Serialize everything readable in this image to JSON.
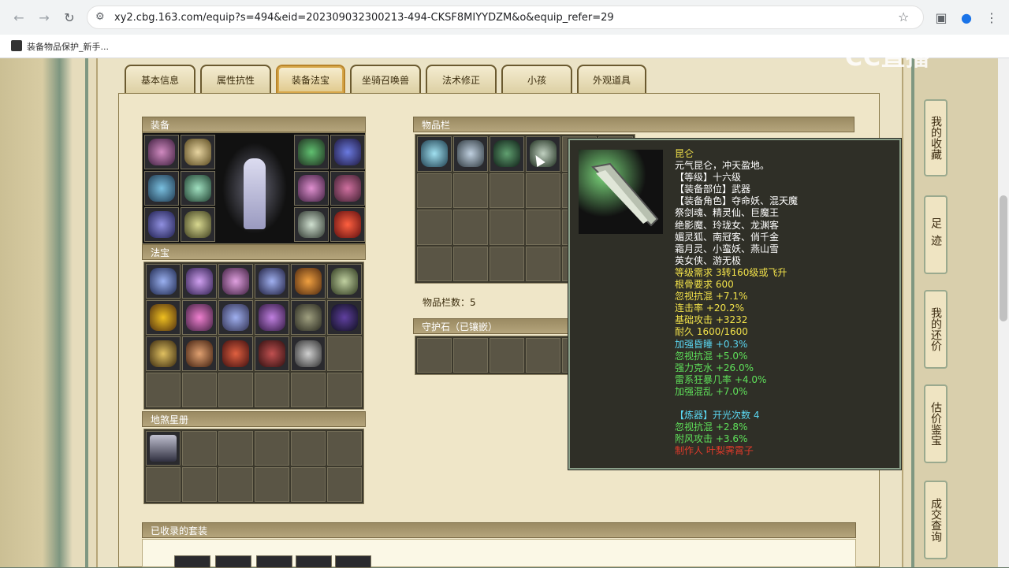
{
  "browser": {
    "url": "xy2.cbg.163.com/equip?s=494&eid=202309032300213-494-CKSF8MIYYDZM&o&equip_refer=29",
    "bookmark": "装备物品保护_新手..."
  },
  "tabs": [
    "基本信息",
    "属性抗性",
    "装备法宝",
    "坐骑召唤兽",
    "法术修正",
    "小孩",
    "外观道具"
  ],
  "panels": {
    "equip": "装备",
    "fabao": "法宝",
    "disha": "地煞星册",
    "inventory": "物品栏",
    "inventory_count": "物品栏数：5",
    "guardian": "守护石（已镶嵌）",
    "suits": "已收录的套装"
  },
  "tooltip": {
    "name": "昆仑",
    "lines": [
      {
        "text": "元气昆仑，冲天盈地。",
        "color": "#ffffff"
      },
      {
        "text": "【等级】十六级",
        "color": "#ffffff"
      },
      {
        "text": "【装备部位】武器",
        "color": "#ffffff"
      },
      {
        "text": "【装备角色】夺命妖、混天魔",
        "color": "#ffffff"
      },
      {
        "text": "祭剑魂、精灵仙、巨魔王",
        "color": "#ffffff"
      },
      {
        "text": "绝影魔、玲珑女、龙渊客",
        "color": "#ffffff"
      },
      {
        "text": "媚灵狐、南冠客、俏千金",
        "color": "#ffffff"
      },
      {
        "text": "霜月灵、小蛮妖、燕山雪",
        "color": "#ffffff"
      },
      {
        "text": "英女侠、游无极",
        "color": "#ffffff"
      },
      {
        "text": "等级需求 3转160级或飞升",
        "color": "#f2e24a"
      },
      {
        "text": "根骨要求 600",
        "color": "#f2e24a"
      },
      {
        "text": "忽视抗混 +7.1%",
        "color": "#f2e24a"
      },
      {
        "text": "连击率 +20.2%",
        "color": "#f2e24a"
      },
      {
        "text": "基础攻击 +3232",
        "color": "#f2e24a"
      },
      {
        "text": "耐久 1600/1600",
        "color": "#f2e24a"
      },
      {
        "text": "加强昏睡 +0.3%",
        "color": "#5ad6f0"
      },
      {
        "text": "忽视抗混 +5.0%",
        "color": "#5fe05a"
      },
      {
        "text": "强力克水 +26.0%",
        "color": "#5fe05a"
      },
      {
        "text": "雷系狂暴几率 +4.0%",
        "color": "#5fe05a"
      },
      {
        "text": "加强混乱 +7.0%",
        "color": "#5fe05a"
      },
      {
        "text": "",
        "color": "#ffffff"
      },
      {
        "text": "【炼器】开光次数 4",
        "color": "#5ad6f0"
      },
      {
        "text": "忽视抗混 +2.8%",
        "color": "#5fe05a"
      },
      {
        "text": "附风攻击 +3.6%",
        "color": "#5fe05a"
      },
      {
        "text": "制作人 叶梨霁霄子",
        "color": "#e03a2a"
      }
    ]
  },
  "side_buttons": [
    "我的收藏",
    "足迹",
    "我的还价",
    "估价鉴宝",
    "成交查询"
  ],
  "watermark": "CC直播"
}
